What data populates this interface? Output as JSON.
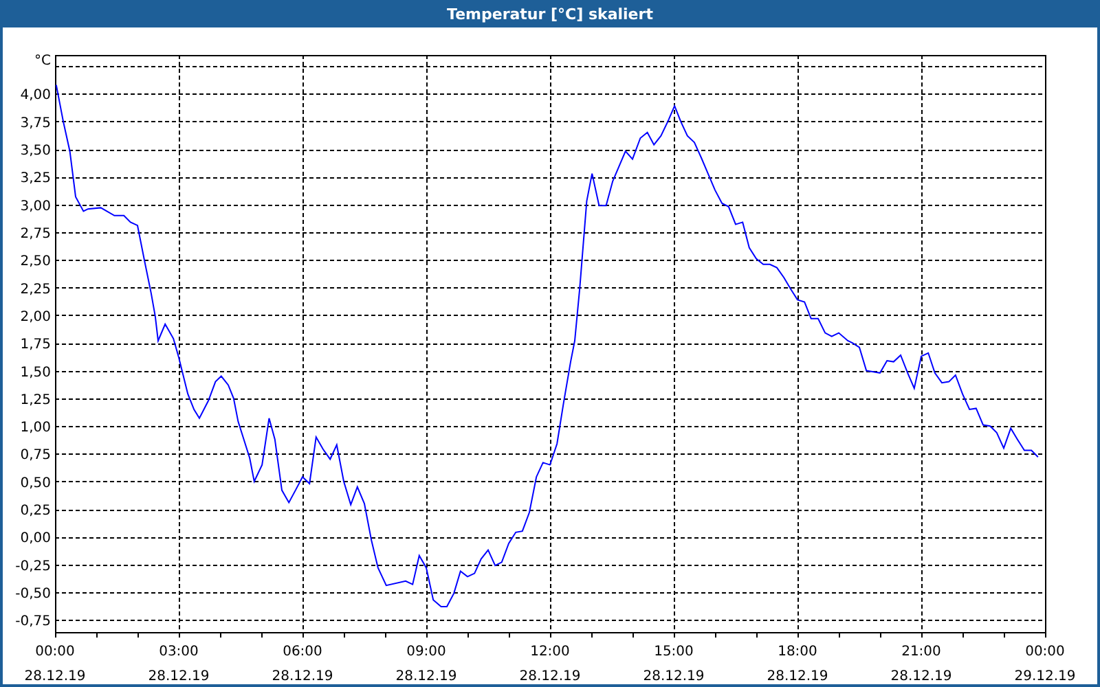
{
  "window": {
    "title": "Temperatur [°C] skaliert"
  },
  "chart": {
    "tick_dates": [
      "28.12.19",
      "28.12.19",
      "28.12.19",
      "28.12.19",
      "28.12.19",
      "28.12.19",
      "28.12.19",
      "28.12.19",
      "29.12.19"
    ],
    "chart_data": {
      "type": "line",
      "grid": true,
      "ylabel": "°C",
      "xlim": [
        0,
        24
      ],
      "ylim": [
        -0.86,
        4.35
      ],
      "xticks": [
        {
          "value": 0,
          "label": "00:00"
        },
        {
          "value": 3,
          "label": "03:00"
        },
        {
          "value": 6,
          "label": "06:00"
        },
        {
          "value": 9,
          "label": "09:00"
        },
        {
          "value": 12,
          "label": "12:00"
        },
        {
          "value": 15,
          "label": "15:00"
        },
        {
          "value": 18,
          "label": "18:00"
        },
        {
          "value": 21,
          "label": "21:00"
        },
        {
          "value": 24,
          "label": "00:00"
        }
      ],
      "yticks": [
        {
          "value": -0.75,
          "label": "-0,75"
        },
        {
          "value": -0.5,
          "label": "-0,50"
        },
        {
          "value": -0.25,
          "label": "-0,25"
        },
        {
          "value": 0,
          "label": "0,00"
        },
        {
          "value": 0.25,
          "label": "0,25"
        },
        {
          "value": 0.5,
          "label": "0,50"
        },
        {
          "value": 0.75,
          "label": "0,75"
        },
        {
          "value": 1,
          "label": "1,00"
        },
        {
          "value": 1.25,
          "label": "1,25"
        },
        {
          "value": 1.5,
          "label": "1,50"
        },
        {
          "value": 1.75,
          "label": "1,75"
        },
        {
          "value": 2,
          "label": "2,00"
        },
        {
          "value": 2.25,
          "label": "2,25"
        },
        {
          "value": 2.5,
          "label": "2,50"
        },
        {
          "value": 2.75,
          "label": "2,75"
        },
        {
          "value": 3,
          "label": "3,00"
        },
        {
          "value": 3.25,
          "label": "3,25"
        },
        {
          "value": 3.5,
          "label": "3,50"
        },
        {
          "value": 3.75,
          "label": "3,75"
        },
        {
          "value": 4,
          "label": "4,00"
        }
      ],
      "x": [
        0.03,
        0.2,
        0.36,
        0.5,
        0.69,
        0.8,
        1.11,
        1.44,
        1.67,
        1.83,
        2,
        2.17,
        2.33,
        2.43,
        2.5,
        2.67,
        2.87,
        3,
        3.22,
        3.37,
        3.5,
        3.72,
        3.89,
        4.03,
        4.2,
        4.33,
        4.44,
        4.72,
        4.83,
        5.02,
        5.19,
        5.33,
        5.5,
        5.67,
        5.83,
        6,
        6.17,
        6.33,
        6.5,
        6.67,
        6.83,
        7,
        7.17,
        7.33,
        7.5,
        7.67,
        7.83,
        8.03,
        8.5,
        8.67,
        8.83,
        9,
        9.17,
        9.36,
        9.5,
        9.67,
        9.83,
        10,
        10.17,
        10.33,
        10.5,
        10.67,
        10.83,
        11,
        11.17,
        11.33,
        11.5,
        11.67,
        11.83,
        12,
        12.17,
        12.33,
        12.5,
        12.6,
        12.72,
        12.89,
        13.02,
        13.19,
        13.36,
        13.52,
        13.83,
        14,
        14.19,
        14.36,
        14.52,
        14.69,
        14.87,
        15.02,
        15.17,
        15.33,
        15.5,
        15.67,
        15.83,
        16,
        16.17,
        16.33,
        16.5,
        16.67,
        16.83,
        17,
        17.17,
        17.33,
        17.5,
        17.67,
        17.83,
        18,
        18.17,
        18.33,
        18.5,
        18.67,
        18.83,
        19,
        19.22,
        19.33,
        19.5,
        19.67,
        20,
        20.17,
        20.33,
        20.5,
        20.67,
        20.83,
        21,
        21.17,
        21.33,
        21.5,
        21.67,
        21.83,
        22,
        22.17,
        22.33,
        22.5,
        22.67,
        22.83,
        23,
        23.17,
        23.33,
        23.5,
        23.67,
        23.83
      ],
      "series": [
        {
          "color": "#0000ff",
          "values": [
            4.08,
            3.75,
            3.48,
            3.07,
            2.94,
            2.96,
            2.97,
            2.9,
            2.9,
            2.84,
            2.81,
            2.49,
            2.2,
            1.99,
            1.77,
            1.92,
            1.79,
            1.62,
            1.29,
            1.15,
            1.07,
            1.23,
            1.4,
            1.45,
            1.37,
            1.25,
            1.04,
            0.71,
            0.5,
            0.65,
            1.07,
            0.88,
            0.42,
            0.31,
            0.42,
            0.54,
            0.48,
            0.9,
            0.79,
            0.7,
            0.83,
            0.5,
            0.29,
            0.45,
            0.3,
            -0.03,
            -0.28,
            -0.44,
            -0.4,
            -0.43,
            -0.17,
            -0.28,
            -0.57,
            -0.63,
            -0.63,
            -0.51,
            -0.31,
            -0.36,
            -0.33,
            -0.2,
            -0.12,
            -0.26,
            -0.23,
            -0.06,
            0.04,
            0.05,
            0.22,
            0.54,
            0.67,
            0.65,
            0.84,
            1.21,
            1.58,
            1.77,
            2.24,
            3.03,
            3.28,
            2.99,
            2.99,
            3.21,
            3.48,
            3.41,
            3.6,
            3.65,
            3.54,
            3.62,
            3.76,
            3.89,
            3.75,
            3.62,
            3.56,
            3.42,
            3.28,
            3.13,
            3.01,
            2.98,
            2.82,
            2.84,
            2.61,
            2.51,
            2.46,
            2.46,
            2.43,
            2.34,
            2.24,
            2.14,
            2.12,
            1.97,
            1.97,
            1.84,
            1.81,
            1.84,
            1.77,
            1.75,
            1.71,
            1.5,
            1.48,
            1.59,
            1.58,
            1.64,
            1.48,
            1.34,
            1.63,
            1.66,
            1.48,
            1.39,
            1.4,
            1.46,
            1.29,
            1.15,
            1.16,
            1.01,
            1,
            0.94,
            0.8,
            0.98,
            0.88,
            0.78,
            0.78,
            0.72
          ]
        }
      ]
    }
  }
}
